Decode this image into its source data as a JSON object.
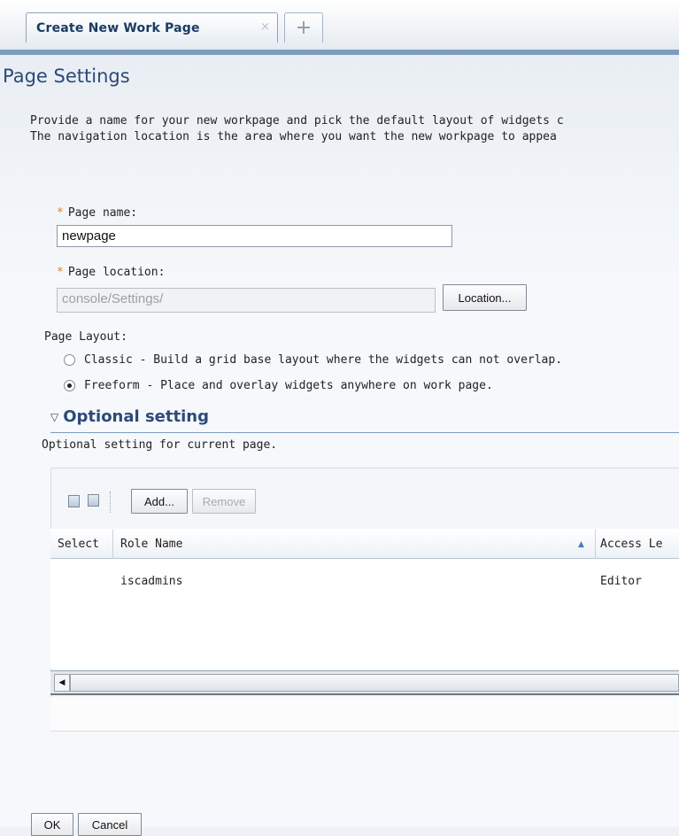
{
  "tabs": {
    "active_label": "Create New Work Page",
    "close_glyph": "×",
    "add_glyph": "+"
  },
  "page": {
    "title": "Page Settings",
    "description_line1": "Provide a name for your new workpage and pick the default layout of widgets c",
    "description_line2": "The navigation location is the area where you want the new workpage to appea"
  },
  "form": {
    "required_marker": "*",
    "page_name_label": "Page name:",
    "page_name_value": "newpage",
    "page_location_label": "Page location:",
    "page_location_value": "console/Settings/",
    "location_button": "Location...",
    "layout_label": "Page Layout:",
    "layout_options": [
      {
        "label": "Classic - Build a grid base layout where the widgets can not overlap.",
        "checked": false
      },
      {
        "label": "Freeform - Place and overlay widgets anywhere on work page.",
        "checked": true
      }
    ]
  },
  "optional": {
    "title": "Optional setting",
    "description": "Optional setting for current page."
  },
  "table": {
    "add_button": "Add...",
    "remove_button": "Remove",
    "columns": [
      "Select",
      "Role Name",
      "Access Le"
    ],
    "rows": [
      {
        "select": "",
        "role_name": "iscadmins",
        "access_level": "Editor"
      }
    ]
  },
  "footer": {
    "ok_button": "OK",
    "cancel_button": "Cancel"
  },
  "colors": {
    "accent": "#2c4a78",
    "required": "#e0802d",
    "tab_strip": "#7f9cbf"
  }
}
